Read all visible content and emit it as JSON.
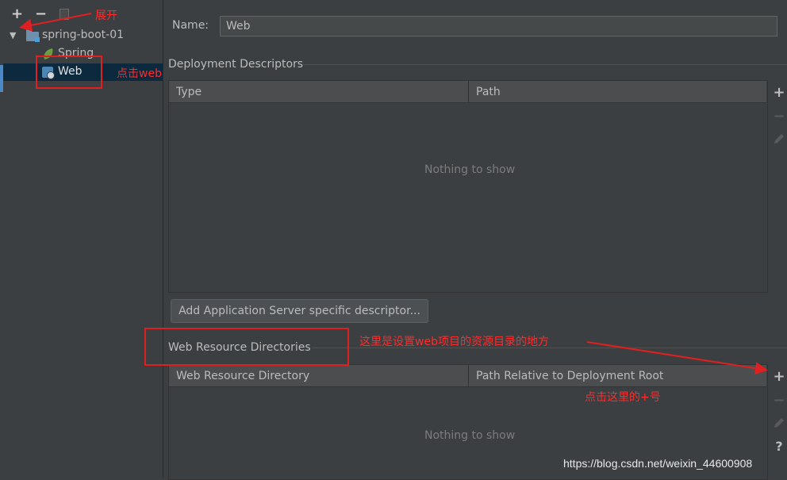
{
  "toolbar": {
    "add_label": "+",
    "remove_label": "−"
  },
  "tree": {
    "project_label": "spring-boot-01",
    "spring_label": "Spring",
    "web_label": "Web"
  },
  "annotations": {
    "expand": "展开",
    "click_web": "点击web",
    "set_resource_dirs": "这里是设置web项目的资源目录的地方",
    "click_plus": "点击这里的+号"
  },
  "form": {
    "name_label": "Name:",
    "name_value": "Web"
  },
  "deployment": {
    "section_title": "Deployment Descriptors",
    "columns": [
      "Type",
      "Path"
    ],
    "empty_text": "Nothing to show",
    "add_button": "Add Application Server specific descriptor..."
  },
  "web_resources": {
    "section_title": "Web Resource Directories",
    "columns": [
      "Web Resource Directory",
      "Path Relative to Deployment Root"
    ],
    "empty_text": "Nothing to show"
  },
  "side_tools": {
    "add": "+",
    "remove": "−",
    "help": "?"
  },
  "watermark": "https://blog.csdn.net/weixin_44600908",
  "colors": {
    "background": "#3c3f41",
    "selection": "#0d293e",
    "annotation_red": "#e02020"
  }
}
